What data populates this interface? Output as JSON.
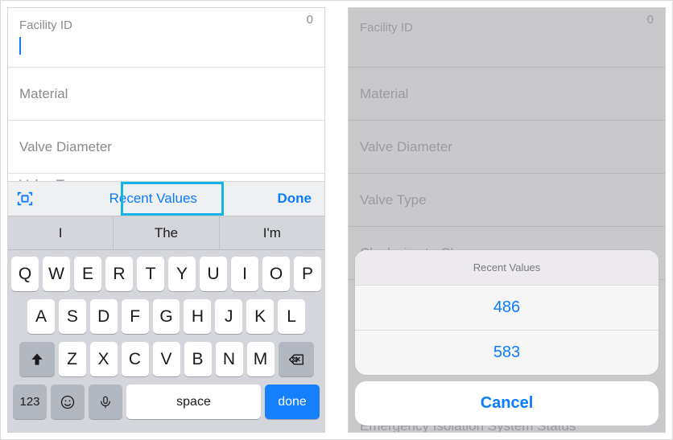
{
  "left": {
    "fields": [
      {
        "label": "Facility ID",
        "count": "0"
      },
      {
        "label": "Material"
      },
      {
        "label": "Valve Diameter"
      },
      {
        "label": "Valve Type"
      }
    ],
    "toolbar": {
      "recent_label": "Recent Values",
      "done_label": "Done"
    },
    "suggestions": [
      "I",
      "The",
      "I'm"
    ],
    "keyboard": {
      "row1": [
        "Q",
        "W",
        "E",
        "R",
        "T",
        "Y",
        "U",
        "I",
        "O",
        "P"
      ],
      "row2": [
        "A",
        "S",
        "D",
        "F",
        "G",
        "H",
        "J",
        "K",
        "L"
      ],
      "row3": [
        "Z",
        "X",
        "C",
        "V",
        "B",
        "N",
        "M"
      ],
      "num_label": "123",
      "space_label": "space",
      "done_label": "done"
    }
  },
  "right": {
    "fields": [
      {
        "label": "Facility ID",
        "count": "0"
      },
      {
        "label": "Material"
      },
      {
        "label": "Valve Diameter"
      },
      {
        "label": "Valve Type"
      },
      {
        "label": "Clockwise to Close"
      },
      {
        "label": "Emergency Isolation System Status"
      }
    ],
    "sheet": {
      "title": "Recent Values",
      "items": [
        "486",
        "583"
      ],
      "cancel_label": "Cancel"
    }
  }
}
